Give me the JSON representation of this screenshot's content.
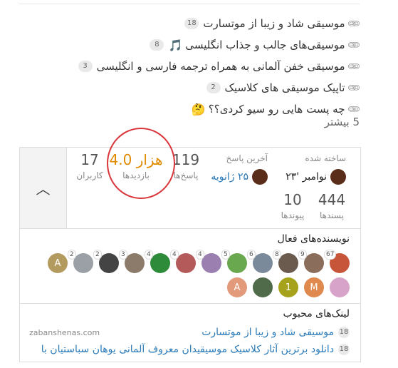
{
  "topics": [
    {
      "title": "موسیقی شاد و زیبا از موتسارت",
      "count": "18",
      "emoji": ""
    },
    {
      "title": "موسیقی‌های جالب و جذاب انگلیسی",
      "count": "8",
      "emoji": "🎵"
    },
    {
      "title": "موسیقی خفن آلمانی به همراه ترجمه فارسی و انگلیسی",
      "count": "3",
      "emoji": ""
    },
    {
      "title": "تاپیک موسیقی های کلاسیک",
      "count": "2",
      "emoji": ""
    },
    {
      "title": "چه پست هایی رو سیو کردی؟؟",
      "count": "",
      "emoji": "🤔"
    }
  ],
  "more": "5 بیشتر",
  "map": {
    "created_label": "ساخته شده",
    "created_value": "نوامبر '۲۳",
    "last_reply_label": "آخرین پاسخ",
    "last_reply_value": "۲۵ ژانویه",
    "replies_num": "119",
    "replies_label": "پاسخ‌ها",
    "views_num": "4.0 هزار",
    "views_label": "بازدیدها",
    "users_num": "17",
    "users_label": "کاربران",
    "likes_num": "444",
    "likes_label": "پسندها",
    "links_num": "10",
    "links_label": "پیوندها"
  },
  "writers": {
    "title": "نویسنده‌های فعال",
    "row1": [
      {
        "label": "",
        "badge": "67",
        "color": "#c7553a"
      },
      {
        "label": "",
        "badge": "9",
        "color": "#8a6d5a"
      },
      {
        "label": "",
        "badge": "8",
        "color": "#6b5a4e"
      },
      {
        "label": "",
        "badge": "6",
        "color": "#7a8a9a"
      },
      {
        "label": "",
        "badge": "5",
        "color": "#6aa84f"
      },
      {
        "label": "",
        "badge": "4",
        "color": "#9a7fb0"
      },
      {
        "label": "",
        "badge": "4",
        "color": "#b55a5a"
      },
      {
        "label": "",
        "badge": "4",
        "color": "#2e8b3a"
      },
      {
        "label": "",
        "badge": "3",
        "color": "#8c7b6a"
      },
      {
        "label": "",
        "badge": "2",
        "color": "#444444"
      },
      {
        "label": "",
        "badge": "2",
        "color": "#9aa0a6"
      },
      {
        "label": "A",
        "badge": "",
        "color": "#b39b5f"
      }
    ],
    "row2": [
      {
        "label": "",
        "badge": "",
        "color": "#d7a3c9"
      },
      {
        "label": "M",
        "badge": "",
        "color": "#e0894f"
      },
      {
        "label": "1",
        "badge": "",
        "color": "#a7a21c"
      },
      {
        "label": "",
        "badge": "",
        "color": "#4f6b4a"
      },
      {
        "label": "A",
        "badge": "",
        "color": "#e29a7a"
      }
    ]
  },
  "links": {
    "title": "لینک‌های محبوب",
    "items": [
      {
        "count": "18",
        "title": "موسیقی شاد و زیبا از موتسارت",
        "domain": "zabanshenas.com"
      },
      {
        "count": "18",
        "title": "دانلود برترین آثار کلاسیک موسیقیدان معروف آلمانی یوهان سباستیان با",
        "domain": ""
      }
    ]
  },
  "colors": {
    "accent": "#2a7ab8",
    "views": "#e08a00",
    "annotation": "#d9353a"
  }
}
